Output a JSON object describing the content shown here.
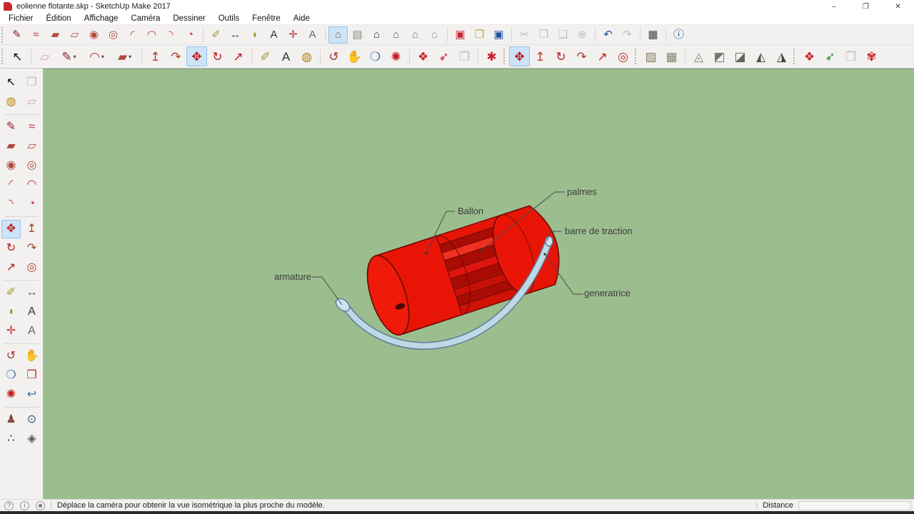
{
  "window": {
    "title": "eolienne flotante.skp - SketchUp Make 2017",
    "controls": [
      {
        "name": "minimize-button",
        "glyph": "–"
      },
      {
        "name": "restore-button",
        "glyph": "❐"
      },
      {
        "name": "close-button",
        "glyph": "✕"
      }
    ]
  },
  "menu": {
    "items": [
      {
        "name": "menu-fichier",
        "label": "Fichier"
      },
      {
        "name": "menu-edition",
        "label": "Édition"
      },
      {
        "name": "menu-affichage",
        "label": "Affichage"
      },
      {
        "name": "menu-camera",
        "label": "Caméra"
      },
      {
        "name": "menu-dessiner",
        "label": "Dessiner"
      },
      {
        "name": "menu-outils",
        "label": "Outils"
      },
      {
        "name": "menu-fenetre",
        "label": "Fenêtre"
      },
      {
        "name": "menu-aide",
        "label": "Aide"
      }
    ]
  },
  "toolbar_row1": {
    "items": [
      {
        "type": "grip"
      },
      {
        "name": "line-tool-icon",
        "glyph": "✎",
        "color": "#8b2020"
      },
      {
        "name": "freehand-tool-icon",
        "glyph": "≈",
        "color": "#c03030"
      },
      {
        "name": "rectangle-tool-icon",
        "glyph": "▰",
        "color": "#b04a3a"
      },
      {
        "name": "rotated-rectangle-tool-icon",
        "glyph": "▱",
        "color": "#b04a3a"
      },
      {
        "name": "circle-tool-icon",
        "glyph": "◉",
        "color": "#b04a3a"
      },
      {
        "name": "polygon-tool-icon",
        "glyph": "◎",
        "color": "#b04a3a"
      },
      {
        "name": "arc-tool-icon",
        "glyph": "◜",
        "color": "#c03030"
      },
      {
        "name": "two-point-arc-tool-icon",
        "glyph": "◠",
        "color": "#c03030"
      },
      {
        "name": "three-point-arc-tool-icon",
        "glyph": "◝",
        "color": "#c03030"
      },
      {
        "name": "pie-tool-icon",
        "glyph": "◔",
        "color": "#c03030"
      },
      {
        "type": "sep"
      },
      {
        "name": "tape-measure-tool-icon",
        "glyph": "✐",
        "color": "#9a9a2e"
      },
      {
        "name": "dimension-tool-icon",
        "glyph": "↔",
        "color": "#555555"
      },
      {
        "name": "protractor-tool-icon",
        "glyph": "◖",
        "color": "#9a9a2e"
      },
      {
        "name": "text-tool-icon",
        "glyph": "A",
        "color": "#333333"
      },
      {
        "name": "axes-tool-icon",
        "glyph": "✛",
        "color": "#c03030"
      },
      {
        "name": "3d-text-tool-icon",
        "glyph": "A",
        "color": "#666666"
      },
      {
        "type": "sep"
      },
      {
        "name": "iso-view-icon",
        "glyph": "⌂",
        "color": "#6b6b5a",
        "state": "active"
      },
      {
        "name": "top-view-icon",
        "glyph": "▤",
        "color": "#8a8a7a"
      },
      {
        "name": "front-view-icon",
        "glyph": "⌂",
        "color": "#333333"
      },
      {
        "name": "right-view-icon",
        "glyph": "⌂",
        "color": "#555555"
      },
      {
        "name": "back-view-icon",
        "glyph": "⌂",
        "color": "#777777"
      },
      {
        "name": "left-view-icon",
        "glyph": "⌂",
        "color": "#999999"
      },
      {
        "type": "sep"
      },
      {
        "name": "new-button",
        "glyph": "▣",
        "color": "#c9252c"
      },
      {
        "name": "open-button",
        "glyph": "❐",
        "color": "#c09a3e"
      },
      {
        "name": "save-button",
        "glyph": "▣",
        "color": "#1f4e9c"
      },
      {
        "type": "sep"
      },
      {
        "name": "cut-button",
        "glyph": "✂",
        "color": "#a8a8a8",
        "state": "disabled"
      },
      {
        "name": "copy-button",
        "glyph": "❐",
        "color": "#a8a8a8",
        "state": "disabled"
      },
      {
        "name": "paste-button",
        "glyph": "❑",
        "color": "#a8a8a8",
        "state": "disabled"
      },
      {
        "name": "delete-button",
        "glyph": "⊗",
        "color": "#a8a8a8",
        "state": "disabled"
      },
      {
        "type": "sep"
      },
      {
        "name": "undo-button",
        "glyph": "↶",
        "color": "#1f4e9c"
      },
      {
        "name": "redo-button",
        "glyph": "↷",
        "color": "#a8a8a8",
        "state": "disabled"
      },
      {
        "type": "sep"
      },
      {
        "name": "print-button",
        "glyph": "▦",
        "color": "#444444"
      },
      {
        "type": "sep"
      },
      {
        "name": "model-info-button",
        "glyph": "ⓘ",
        "color": "#1f4e9c"
      }
    ]
  },
  "toolbar_row2": {
    "items": [
      {
        "type": "grip"
      },
      {
        "name": "select-tool-icon",
        "glyph": "↖",
        "color": "#111111"
      },
      {
        "type": "sep"
      },
      {
        "name": "eraser-tool-icon",
        "glyph": "▱",
        "color": "#e09cb0"
      },
      {
        "name": "line-tool-icon",
        "glyph": "✎",
        "color": "#8b2020",
        "dropdown": true
      },
      {
        "name": "arc-tool-icon",
        "glyph": "◠",
        "color": "#c03030",
        "dropdown": true
      },
      {
        "name": "rectangle-tool-icon",
        "glyph": "▰",
        "color": "#b04a3a",
        "dropdown": true
      },
      {
        "type": "sep"
      },
      {
        "name": "push-pull-tool-icon",
        "glyph": "↥",
        "color": "#b03a2a"
      },
      {
        "name": "follow-me-tool-icon",
        "glyph": "↷",
        "color": "#b03a2a"
      },
      {
        "name": "move-tool-icon",
        "glyph": "✥",
        "color": "#c01818",
        "state": "active"
      },
      {
        "name": "rotate-tool-icon",
        "glyph": "↻",
        "color": "#c01818"
      },
      {
        "name": "scale-tool-icon",
        "glyph": "↗",
        "color": "#c01818"
      },
      {
        "type": "sep"
      },
      {
        "name": "tape-measure-tool-icon",
        "glyph": "✐",
        "color": "#9a9a2e"
      },
      {
        "name": "text-tool-icon",
        "glyph": "A",
        "color": "#333333"
      },
      {
        "name": "paint-bucket-tool-icon",
        "glyph": "◍",
        "color": "#b8860b"
      },
      {
        "type": "sep"
      },
      {
        "name": "orbit-tool-icon",
        "glyph": "↺",
        "color": "#b03030"
      },
      {
        "name": "pan-tool-icon",
        "glyph": "✋",
        "color": "#d9a066"
      },
      {
        "name": "zoom-tool-icon",
        "glyph": "❍",
        "color": "#3a6ea5"
      },
      {
        "name": "zoom-extents-icon",
        "glyph": "✺",
        "color": "#c01818"
      },
      {
        "type": "sep"
      },
      {
        "name": "get-models-button",
        "glyph": "❖",
        "color": "#c9252c"
      },
      {
        "name": "share-model-button",
        "glyph": "➶",
        "color": "#c9252c"
      },
      {
        "name": "send-to-layout-button",
        "glyph": "❒",
        "color": "#a8a8a8",
        "state": "disabled"
      },
      {
        "type": "sep"
      },
      {
        "name": "extension-warehouse-button",
        "glyph": "✱",
        "color": "#c9252c"
      },
      {
        "type": "grip"
      },
      {
        "name": "move-tool-icon",
        "glyph": "✥",
        "color": "#c01818",
        "state": "active"
      },
      {
        "name": "push-pull-tool-icon",
        "glyph": "↥",
        "color": "#b03a2a"
      },
      {
        "name": "rotate-tool-icon",
        "glyph": "↻",
        "color": "#c01818"
      },
      {
        "name": "follow-me-tool-icon",
        "glyph": "↷",
        "color": "#b03a2a"
      },
      {
        "name": "scale-tool-icon",
        "glyph": "↗",
        "color": "#c01818"
      },
      {
        "name": "offset-tool-icon",
        "glyph": "◎",
        "color": "#b03a2a"
      },
      {
        "type": "grip"
      },
      {
        "name": "from-contours-tool-icon",
        "glyph": "▨",
        "color": "#8a7a66"
      },
      {
        "name": "from-scratch-tool-icon",
        "glyph": "▦",
        "color": "#7a8a66"
      },
      {
        "type": "sep"
      },
      {
        "name": "smoove-tool-icon",
        "glyph": "◬",
        "color": "#8a8a77"
      },
      {
        "name": "stamp-tool-icon",
        "glyph": "◩",
        "color": "#777766"
      },
      {
        "name": "drape-tool-icon",
        "glyph": "◪",
        "color": "#666655"
      },
      {
        "name": "add-detail-tool-icon",
        "glyph": "◭",
        "color": "#555544"
      },
      {
        "name": "flip-edge-tool-icon",
        "glyph": "◮",
        "color": "#444433"
      },
      {
        "type": "grip"
      },
      {
        "name": "get-models-button",
        "glyph": "❖",
        "color": "#c9252c"
      },
      {
        "name": "share-model-button",
        "glyph": "➶",
        "color": "#2a8a2a"
      },
      {
        "name": "share-component-button",
        "glyph": "❒",
        "color": "#a8a8a8",
        "state": "disabled"
      },
      {
        "name": "extension-warehouse-button",
        "glyph": "✾",
        "color": "#c9252c"
      }
    ]
  },
  "sidebar": {
    "items": [
      {
        "name": "select-tool-icon",
        "glyph": "↖",
        "color": "#111111"
      },
      {
        "name": "make-component-icon",
        "glyph": "❒",
        "color": "#a8a8a8",
        "state": "disabled"
      },
      {
        "name": "paint-bucket-tool-icon",
        "glyph": "◍",
        "color": "#b8860b"
      },
      {
        "name": "eraser-tool-icon",
        "glyph": "▱",
        "color": "#e09cb0"
      },
      {
        "type": "sep"
      },
      {
        "name": "line-tool-icon",
        "glyph": "✎",
        "color": "#8b2020"
      },
      {
        "name": "freehand-tool-icon",
        "glyph": "≈",
        "color": "#c03030"
      },
      {
        "name": "rectangle-tool-icon",
        "glyph": "▰",
        "color": "#b04a3a"
      },
      {
        "name": "rotated-rectangle-tool-icon",
        "glyph": "▱",
        "color": "#b04a3a"
      },
      {
        "name": "circle-tool-icon",
        "glyph": "◉",
        "color": "#b04a3a"
      },
      {
        "name": "polygon-tool-icon",
        "glyph": "◎",
        "color": "#b04a3a"
      },
      {
        "name": "arc-tool-icon",
        "glyph": "◜",
        "color": "#c03030"
      },
      {
        "name": "two-point-arc-tool-icon",
        "glyph": "◠",
        "color": "#c03030"
      },
      {
        "name": "three-point-arc-tool-icon",
        "glyph": "◝",
        "color": "#c03030"
      },
      {
        "name": "pie-tool-icon",
        "glyph": "◔",
        "color": "#c03030"
      },
      {
        "type": "sep"
      },
      {
        "name": "move-tool-icon",
        "glyph": "✥",
        "color": "#c01818",
        "state": "active"
      },
      {
        "name": "push-pull-tool-icon",
        "glyph": "↥",
        "color": "#b03a2a"
      },
      {
        "name": "rotate-tool-icon",
        "glyph": "↻",
        "color": "#c01818"
      },
      {
        "name": "follow-me-tool-icon",
        "glyph": "↷",
        "color": "#b03a2a"
      },
      {
        "name": "scale-tool-icon",
        "glyph": "↗",
        "color": "#c01818"
      },
      {
        "name": "offset-tool-icon",
        "glyph": "◎",
        "color": "#b03a2a"
      },
      {
        "type": "sep"
      },
      {
        "name": "tape-measure-tool-icon",
        "glyph": "✐",
        "color": "#9a9a2e"
      },
      {
        "name": "dimension-tool-icon",
        "glyph": "↔",
        "color": "#555555"
      },
      {
        "name": "protractor-tool-icon",
        "glyph": "◖",
        "color": "#9a9a2e"
      },
      {
        "name": "text-tool-icon",
        "glyph": "A",
        "color": "#333333"
      },
      {
        "name": "axes-tool-icon",
        "glyph": "✛",
        "color": "#c03030"
      },
      {
        "name": "3d-text-tool-icon",
        "glyph": "A",
        "color": "#666666"
      },
      {
        "type": "sep"
      },
      {
        "name": "orbit-tool-icon",
        "glyph": "↺",
        "color": "#b03030"
      },
      {
        "name": "pan-tool-icon",
        "glyph": "✋",
        "color": "#d9a066"
      },
      {
        "name": "zoom-tool-icon",
        "glyph": "❍",
        "color": "#3a6ea5"
      },
      {
        "name": "zoom-window-tool-icon",
        "glyph": "❒",
        "color": "#c03030"
      },
      {
        "name": "zoom-extents-icon",
        "glyph": "✺",
        "color": "#c01818"
      },
      {
        "name": "previous-view-icon",
        "glyph": "↩",
        "color": "#3a6ea5"
      },
      {
        "type": "sep"
      },
      {
        "name": "position-camera-tool-icon",
        "glyph": "♟",
        "color": "#8a4a3a"
      },
      {
        "name": "look-around-tool-icon",
        "glyph": "⊙",
        "color": "#335577"
      },
      {
        "name": "walk-tool-icon",
        "glyph": "∴",
        "color": "#222222"
      },
      {
        "name": "section-plane-tool-icon",
        "glyph": "◈",
        "color": "#555555"
      }
    ]
  },
  "viewport": {
    "background_color": "#9cbe8e",
    "model_colors": {
      "body": "#e81507",
      "edges": "#6b0c05",
      "traction_bar": "#bed8e6"
    },
    "labels": [
      {
        "text": "palmes"
      },
      {
        "text": "Ballon"
      },
      {
        "text": "barre de traction"
      },
      {
        "text": "generatrice"
      },
      {
        "text": "armature"
      }
    ]
  },
  "statusbar": {
    "icons": [
      {
        "name": "help-icon",
        "glyph": "?"
      },
      {
        "name": "info-icon",
        "glyph": "i"
      },
      {
        "name": "user-icon",
        "glyph": "☻"
      }
    ],
    "separator": "|",
    "message": "Déplace la caméra pour obtenir la vue isométrique la plus proche du modèle.",
    "distance_label": "Distance",
    "measurement_value": ""
  }
}
